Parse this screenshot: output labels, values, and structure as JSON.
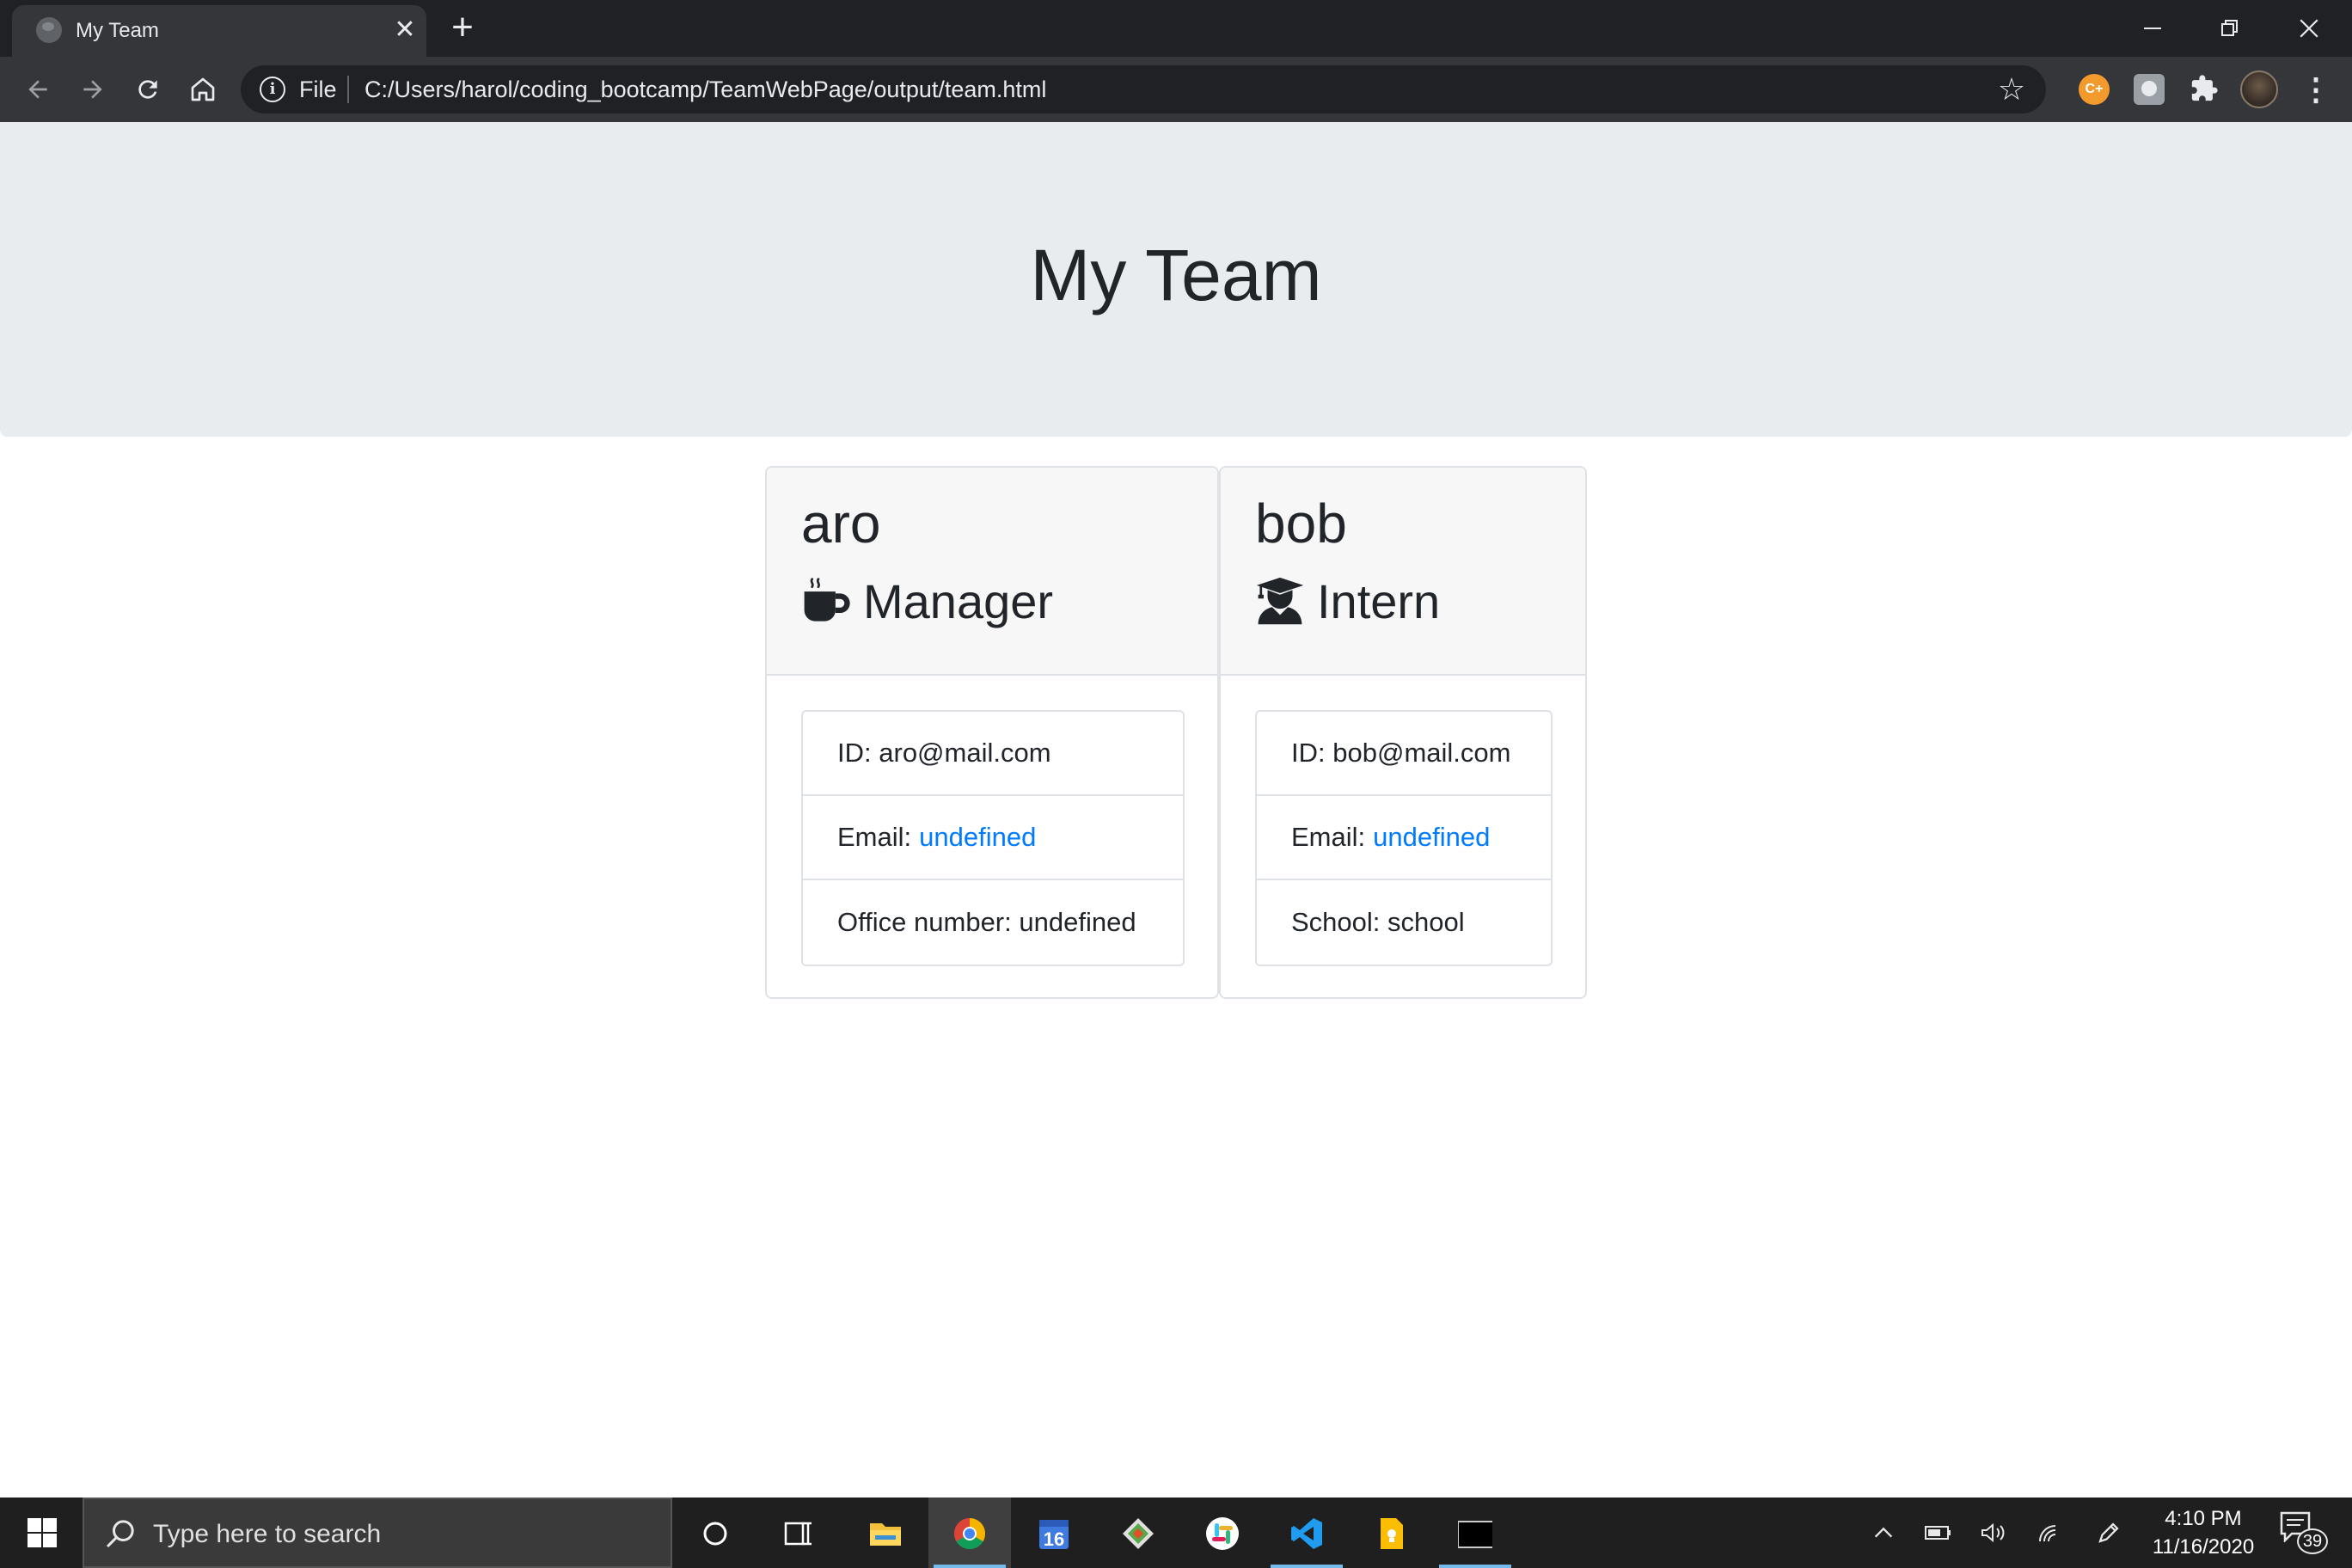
{
  "browser": {
    "tab_title": "My Team",
    "tab_close": "✕",
    "new_tab": "+",
    "scheme_label": "File",
    "url": "C:/Users/harol/coding_bootcamp/TeamWebPage/output/team.html",
    "icons": [
      "back-arrow-icon",
      "forward-arrow-icon",
      "reload-icon",
      "home-icon",
      "info-icon",
      "star-icon",
      "extension-icon",
      "puzzle-icon",
      "menu-icon"
    ]
  },
  "page": {
    "title": "My Team"
  },
  "team": [
    {
      "name": "aro",
      "role": "Manager",
      "role_icon": "mug-icon",
      "details": [
        {
          "label": "ID:",
          "value": "aro@mail.com",
          "is_link": false
        },
        {
          "label": "Email:",
          "value": "undefined",
          "is_link": true
        },
        {
          "label": "Office number:",
          "value": "undefined",
          "is_link": false
        }
      ]
    },
    {
      "name": "bob",
      "role": "Intern",
      "role_icon": "graduate-icon",
      "details": [
        {
          "label": "ID:",
          "value": "bob@mail.com",
          "is_link": false
        },
        {
          "label": "Email:",
          "value": "undefined",
          "is_link": true
        },
        {
          "label": "School:",
          "value": "school",
          "is_link": false
        }
      ]
    }
  ],
  "taskbar": {
    "search_placeholder": "Type here to search",
    "calendar_day": "16",
    "time": "4:10 PM",
    "date": "11/16/2020",
    "notification_count": "39",
    "apps": [
      "cortana",
      "task-view",
      "file-explorer",
      "chrome",
      "calendar",
      "git",
      "slack",
      "vscode",
      "keep",
      "terminal"
    ]
  },
  "colors": {
    "jumbotron": "#e9ecef",
    "link": "#007bff",
    "card_header": "#f7f7f7",
    "chrome_dark": "#202124",
    "taskbar": "#1f1f1f"
  }
}
